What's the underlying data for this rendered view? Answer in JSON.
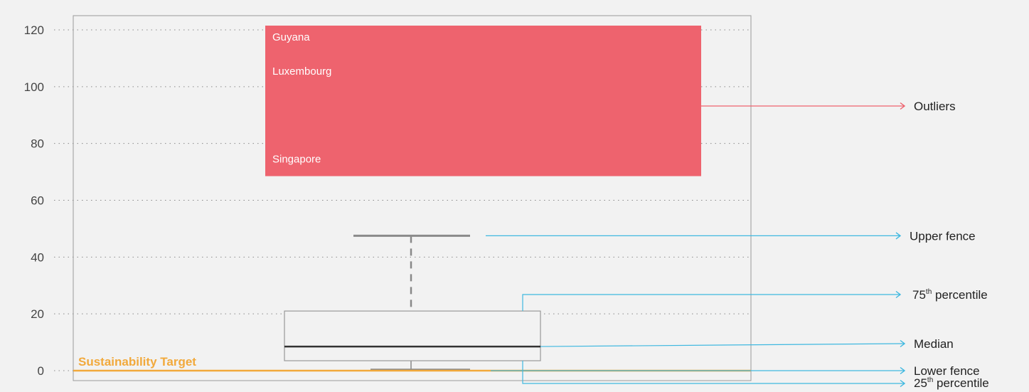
{
  "chart_data": {
    "type": "box",
    "title": "",
    "xlabel": "",
    "ylabel": "",
    "ylim": [
      -3,
      125
    ],
    "yticks": [
      0,
      20,
      40,
      60,
      80,
      100,
      120
    ],
    "grid": true,
    "box": {
      "lower_fence": 0.3,
      "q1": 3.5,
      "median": 8.5,
      "q3": 21,
      "upper_fence": 47.5
    },
    "outlier_region": {
      "y_low": 68.5,
      "y_high": 121.5,
      "color": "#ee636e"
    },
    "outliers": [
      {
        "label": "Guyana",
        "value": 117
      },
      {
        "label": "Luxembourg",
        "value": 105
      },
      {
        "label": "Singapore",
        "value": 74
      }
    ],
    "target": {
      "label": "Sustainability Target",
      "value": 0,
      "color": "#f2a93b"
    },
    "annotations": [
      {
        "label": "Outliers",
        "sup": "",
        "color": "#ee636e"
      },
      {
        "label": "Upper fence",
        "sup": "",
        "color": "#3fb8e0"
      },
      {
        "label": "75",
        "sup": "th",
        "tail": " percentile",
        "color": "#3fb8e0"
      },
      {
        "label": "Median",
        "sup": "",
        "color": "#3fb8e0"
      },
      {
        "label": "Lower fence",
        "sup": "",
        "color": "#3fb8e0"
      },
      {
        "label": "25",
        "sup": "th",
        "tail": " percentile",
        "color": "#3fb8e0"
      }
    ]
  }
}
